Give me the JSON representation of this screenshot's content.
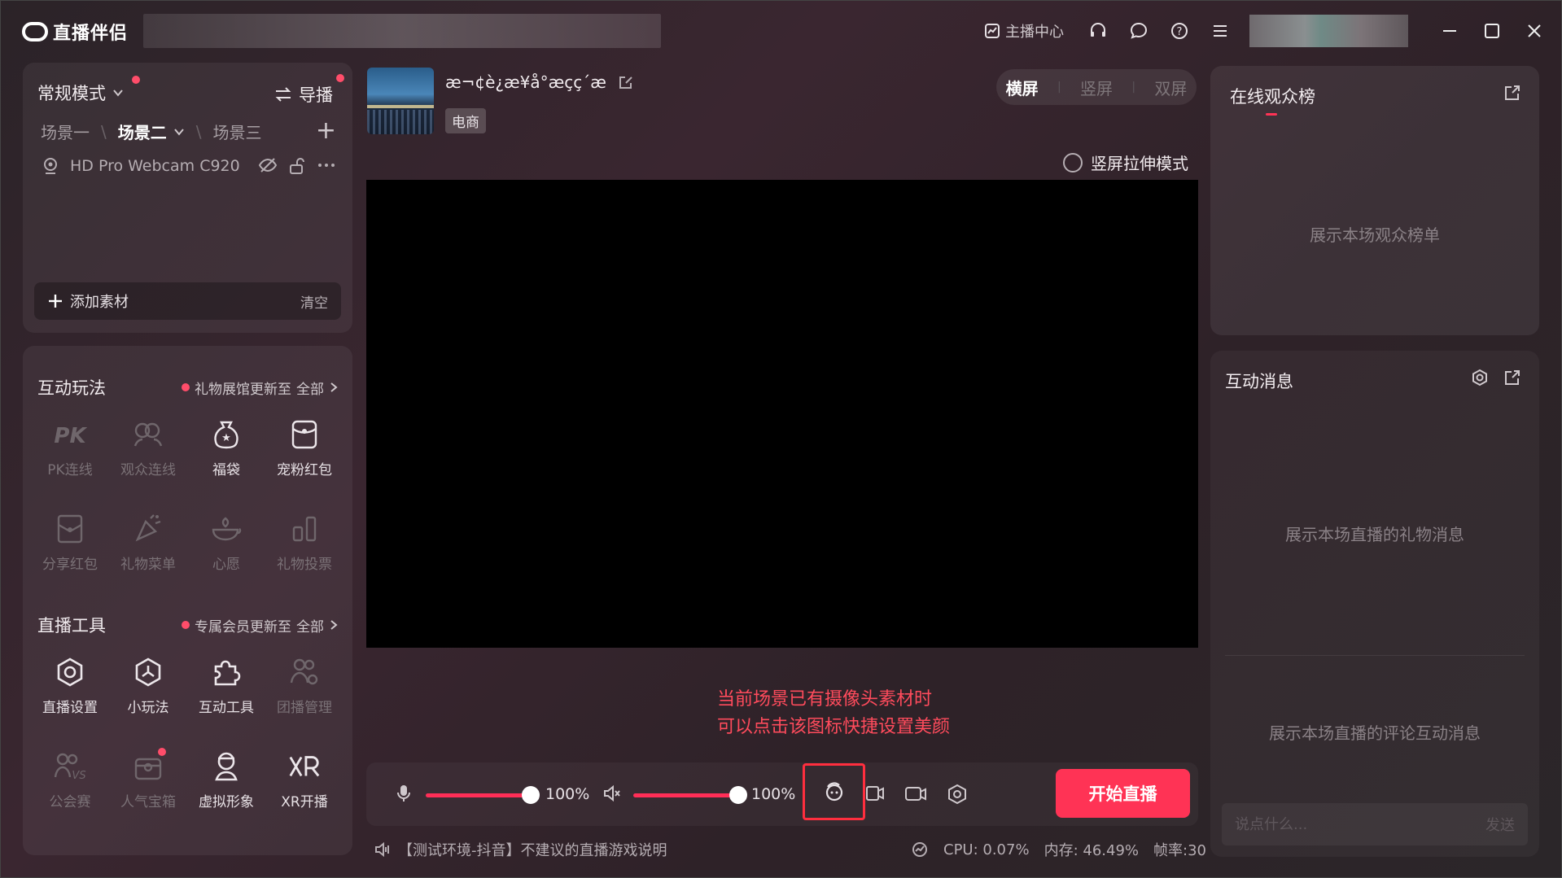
{
  "app": {
    "name": "直播伴侣"
  },
  "header": {
    "streamer_center": "主播中心"
  },
  "scene_panel": {
    "mode": "常规模式",
    "guide": "导播",
    "scenes": [
      "场景一",
      "场景二",
      "场景三"
    ],
    "active_scene": "场景二",
    "source_name": "HD Pro Webcam C920",
    "add_source": "添加素材",
    "clear": "清空"
  },
  "interactive": {
    "title": "互动玩法",
    "note": "礼物展馆更新至",
    "all": "全部",
    "items": [
      {
        "label": "PK连线",
        "icon": "pk-icon",
        "dim": true
      },
      {
        "label": "观众连线",
        "icon": "audience-link-icon",
        "dim": true
      },
      {
        "label": "福袋",
        "icon": "lucky-bag-icon",
        "dim": false
      },
      {
        "label": "宠粉红包",
        "icon": "red-packet-icon",
        "dim": false
      },
      {
        "label": "分享红包",
        "icon": "share-packet-icon",
        "dim": true
      },
      {
        "label": "礼物菜单",
        "icon": "gift-menu-icon",
        "dim": true
      },
      {
        "label": "心愿",
        "icon": "wish-icon",
        "dim": true
      },
      {
        "label": "礼物投票",
        "icon": "gift-vote-icon",
        "dim": true
      }
    ]
  },
  "tools": {
    "title": "直播工具",
    "note": "专属会员更新至",
    "all": "全部",
    "items": [
      {
        "label": "直播设置",
        "icon": "live-settings-icon",
        "dim": false
      },
      {
        "label": "小玩法",
        "icon": "mini-game-icon",
        "dim": false
      },
      {
        "label": "互动工具",
        "icon": "puzzle-icon",
        "dim": false
      },
      {
        "label": "团播管理",
        "icon": "group-manage-icon",
        "dim": true
      },
      {
        "label": "公会赛",
        "icon": "guild-match-icon",
        "dim": true
      },
      {
        "label": "人气宝箱",
        "icon": "treasure-box-icon",
        "dim": true
      },
      {
        "label": "虚拟形象",
        "icon": "avatar-figure-icon",
        "dim": false
      },
      {
        "label": "XR开播",
        "icon": "xr-icon",
        "dim": false
      }
    ]
  },
  "room": {
    "title": "æ¬¢è¿æ¥å°æçç´æ",
    "tag": "电商"
  },
  "orientation": {
    "landscape": "横屏",
    "portrait": "竖屏",
    "dual": "双屏"
  },
  "stretch_mode": "竖屏拉伸模式",
  "hint": {
    "line1": "当前场景已有摄像头素材时",
    "line2": "可以点击该图标快捷设置美颜"
  },
  "controls": {
    "mic_volume": "100%",
    "speaker_volume": "100%",
    "go_live": "开始直播"
  },
  "status_bar": {
    "notice": "【测试环境-抖音】不建议的直播游戏说明",
    "cpu": "CPU: 0.07%",
    "memory": "内存: 46.49%",
    "fps": "帧率:30"
  },
  "rank_panel": {
    "title": "在线观众榜",
    "empty": "展示本场观众榜单"
  },
  "msg_panel": {
    "title": "互动消息",
    "gift_empty": "展示本场直播的礼物消息",
    "comment_empty": "展示本场直播的评论互动消息",
    "placeholder": "说点什么...",
    "send": "发送"
  },
  "colors": {
    "accent": "#ff3355",
    "hint": "#ff4b5c"
  }
}
